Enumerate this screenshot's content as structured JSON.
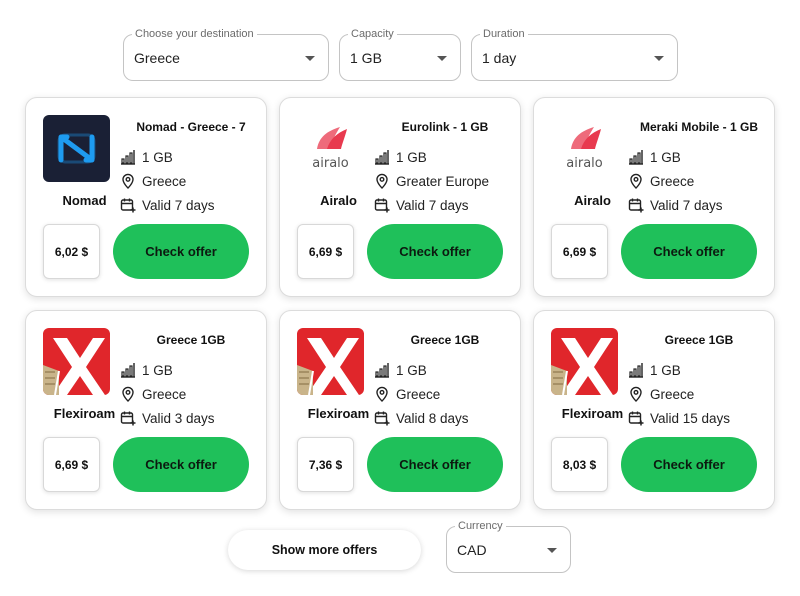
{
  "filters": {
    "destination": {
      "label": "Choose your destination",
      "value": "Greece"
    },
    "capacity": {
      "label": "Capacity",
      "value": "1 GB"
    },
    "duration": {
      "label": "Duration",
      "value": "1 day"
    }
  },
  "offers": [
    {
      "brand": "Nomad",
      "logo": "nomad-logo",
      "title": "Nomad - Greece - 7",
      "data": "1 GB",
      "region": "Greece",
      "validity": "Valid 7 days",
      "price": "6,02 $",
      "cta": "Check offer"
    },
    {
      "brand": "Airalo",
      "logo": "airalo-logo",
      "logo_text": "airalo",
      "title": "Eurolink - 1 GB",
      "data": "1 GB",
      "region": "Greater Europe",
      "validity": "Valid 7 days",
      "price": "6,69 $",
      "cta": "Check offer"
    },
    {
      "brand": "Airalo",
      "logo": "airalo-logo",
      "logo_text": "airalo",
      "title": "Meraki Mobile - 1 GB",
      "data": "1 GB",
      "region": "Greece",
      "validity": "Valid 7 days",
      "price": "6,69 $",
      "cta": "Check offer"
    },
    {
      "brand": "Flexiroam",
      "logo": "flexiroam-logo",
      "title": "Greece 1GB",
      "data": "1 GB",
      "region": "Greece",
      "validity": "Valid 3 days",
      "price": "6,69 $",
      "cta": "Check offer"
    },
    {
      "brand": "Flexiroam",
      "logo": "flexiroam-logo",
      "title": "Greece 1GB",
      "data": "1 GB",
      "region": "Greece",
      "validity": "Valid 8 days",
      "price": "7,36 $",
      "cta": "Check offer"
    },
    {
      "brand": "Flexiroam",
      "logo": "flexiroam-logo",
      "title": "Greece 1GB",
      "data": "1 GB",
      "region": "Greece",
      "validity": "Valid 15 days",
      "price": "8,03 $",
      "cta": "Check offer"
    }
  ],
  "icons": {
    "data": "signal-bars-icon",
    "region": "location-pin-icon",
    "validity": "calendar-add-icon",
    "select": "chevron-down-icon"
  },
  "colors": {
    "cta": "#1fc05a",
    "nomad_bg": "#1a2035",
    "nomad_accent": "#1e9bf0",
    "airalo": "#e83a4f",
    "flexiroam": "#e0262b"
  },
  "footer": {
    "show_more": "Show more offers",
    "currency": {
      "label": "Currency",
      "value": "CAD"
    }
  }
}
